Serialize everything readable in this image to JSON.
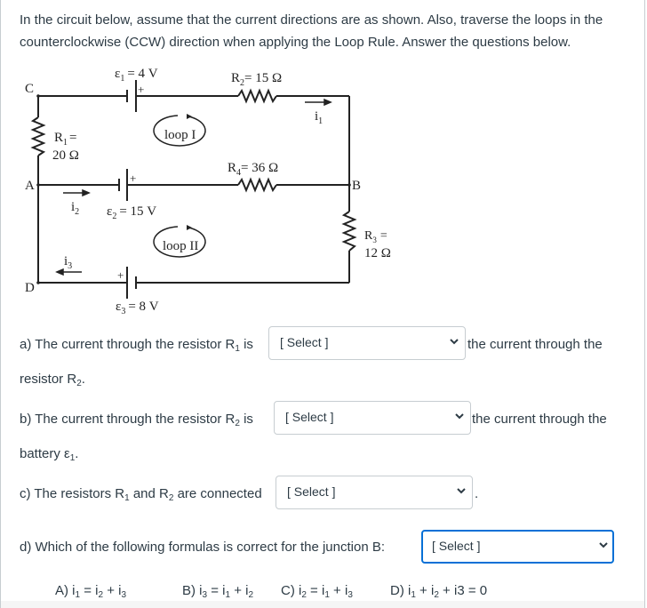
{
  "intro": {
    "text": "In the circuit below, assume that the current directions are as shown. Also, traverse the loops in the counterclockwise (CCW) direction when applying the Loop Rule. Answer the questions below."
  },
  "circuit": {
    "nodes": {
      "C": "C",
      "A": "A",
      "D": "D",
      "B": "B"
    },
    "emf1": {
      "symbol": "ε",
      "sub": "1",
      "value": "= 4 V",
      "plus": "+"
    },
    "emf2": {
      "symbol": "ε",
      "sub": "2",
      "value": "= 15 V",
      "plus": "+"
    },
    "emf3": {
      "symbol": "ε",
      "sub": "3",
      "value": "= 8 V",
      "plus": "+"
    },
    "r1": {
      "name": "R",
      "sub": "1",
      "eq": "=",
      "value": "20 Ω"
    },
    "r2": {
      "name": "R",
      "sub": "2",
      "value": "= 15 Ω"
    },
    "r3": {
      "name": "R",
      "sub": "3",
      "eq": "=",
      "value": "12 Ω"
    },
    "r4": {
      "name": "R",
      "sub": "4",
      "value": "= 36 Ω"
    },
    "i1": {
      "name": "i",
      "sub": "1"
    },
    "i2": {
      "name": "i",
      "sub": "2"
    },
    "i3": {
      "name": "i",
      "sub": "3"
    },
    "loop1": "loop I",
    "loop2": "loop II"
  },
  "questions": {
    "a": {
      "pre": "a) The current through the resistor R",
      "pre_sub": "1",
      "pre_end": " is",
      "post": "the current through the",
      "line2": "resistor R",
      "line2_sub": "2",
      "line2_end": ".",
      "select": "[ Select ]"
    },
    "b": {
      "pre": "b)  The current through the resistor R",
      "pre_sub": "2",
      "pre_end": " is",
      "post": "the current through the",
      "line2": "battery ε",
      "line2_sub": "1",
      "line2_end": ".",
      "select": "[ Select ]"
    },
    "c": {
      "pre": "c) The resistors R",
      "sub1": "1",
      "mid": " and R",
      "sub2": "2",
      "end": " are connected",
      "post": ".",
      "select": "[ Select ]"
    },
    "d": {
      "pre": "d)  Which of the following formulas is correct for the junction B:",
      "select": "[ Select ]",
      "options": [
        {
          "label": "A) i",
          "s1": "1",
          "t1": " = i",
          "s2": "2",
          "t2": " + i",
          "s3": "3",
          "t3": ""
        },
        {
          "label": "B)  i",
          "s1": "3",
          "t1": " = i",
          "s2": "1",
          "t2": " + i",
          "s3": "2",
          "t3": ""
        },
        {
          "label": "C)  i",
          "s1": "2",
          "t1": " = i",
          "s2": "1",
          "t2": " + i",
          "s3": "3",
          "t3": ""
        },
        {
          "label": "D)  i",
          "s1": "1",
          "t1": " + i",
          "s2": "2",
          "t2": " + i3 = 0",
          "s3": "",
          "t3": ""
        }
      ]
    }
  },
  "colors": {
    "text": "#2d3b45",
    "border": "#c7cdd1",
    "focus": "#0770d6"
  }
}
